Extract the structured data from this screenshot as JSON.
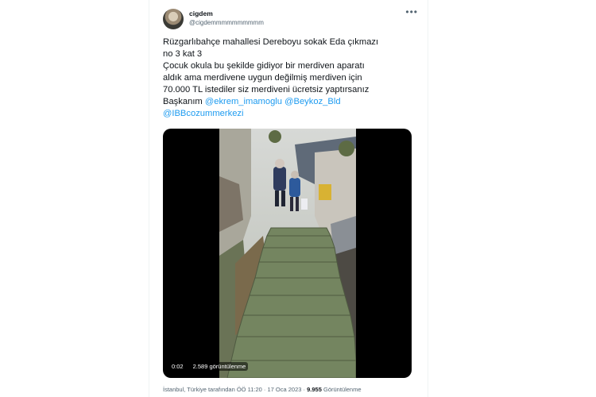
{
  "user": {
    "name": "cigdem",
    "handle": "@cigdemmmmmmmmmm",
    "more_icon": "more-icon"
  },
  "tweet": {
    "lines": [
      "Rüzgarlıbahçe mahallesi Dereboyu sokak Eda çıkmazı",
      "no 3 kat 3",
      "Çocuk okula bu şekilde gidiyor bir merdiven aparatı",
      "aldık ama merdivene uygun değilmiş merdiven için",
      "70.000 TL istediler siz merdiveni ücretsiz yaptırsanız"
    ],
    "line6_prefix": "Başkanım",
    "mention1": "@ekrem_imamoglu",
    "mention2": "@Beykoz_Bld",
    "mention3": "@IBBcozummerkezi"
  },
  "video": {
    "time": "0:02",
    "views": "2.589 görüntülenme"
  },
  "meta": {
    "location": "İstanbul, Türkiye tarafından",
    "datetime": "ÖÖ 11:20 · 17 Oca 2023",
    "view_count": "9.955",
    "view_label": "Görüntülenme"
  }
}
